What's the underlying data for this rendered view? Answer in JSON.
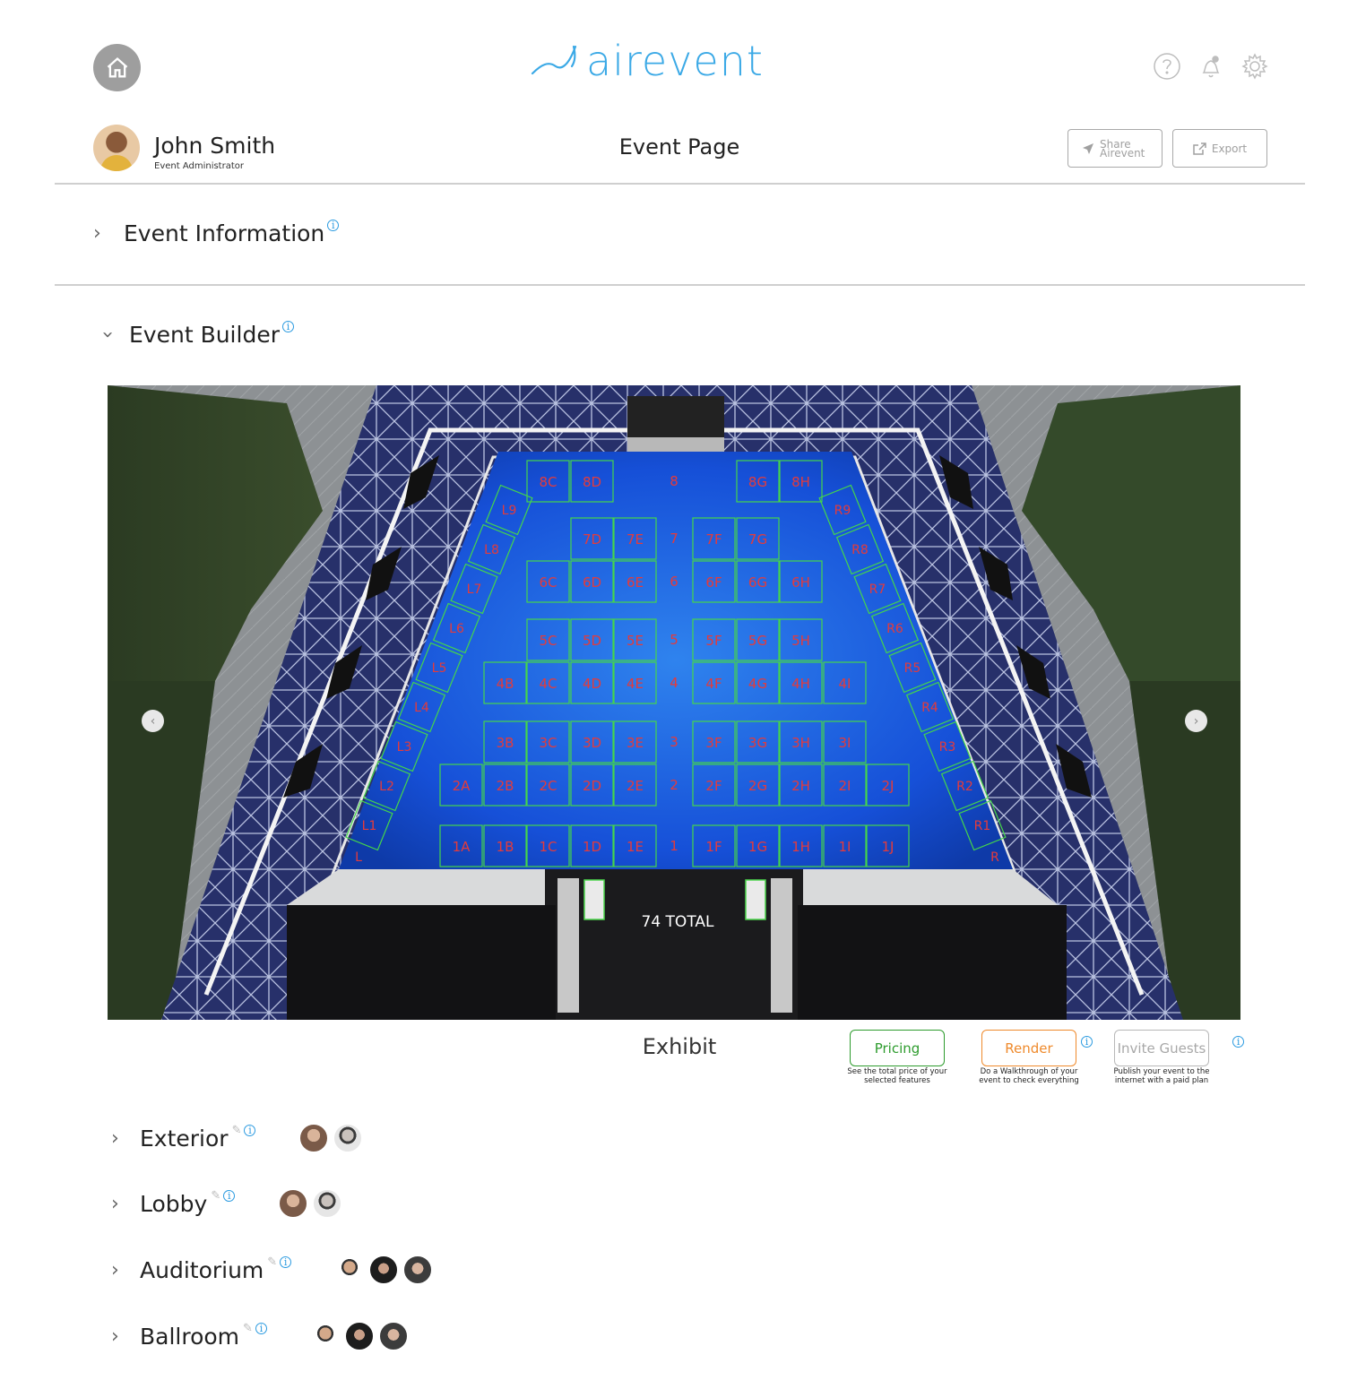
{
  "header": {
    "logo_text": "airevent",
    "home_icon": "home-icon",
    "help_icon": "help-icon",
    "bell_icon": "bell-icon",
    "gear_icon": "gear-icon",
    "brand_color": "#3ba9e6"
  },
  "user": {
    "name": "John Smith",
    "role": "Event Administrator"
  },
  "page": {
    "title": "Event Page",
    "share_label": "Share Airevent",
    "export_label": "Export"
  },
  "sections": {
    "event_information": "Event Information",
    "event_builder": "Event Builder"
  },
  "floorplan": {
    "total_label": "74 TOTAL",
    "row_numbers": [
      "8",
      "7",
      "6",
      "5",
      "4",
      "3",
      "2",
      "1"
    ],
    "booths": [
      "8C",
      "8D",
      "8G",
      "8H",
      "7D",
      "7E",
      "7F",
      "7G",
      "6C",
      "6D",
      "6E",
      "6F",
      "6G",
      "6H",
      "5C",
      "5D",
      "5E",
      "5F",
      "5G",
      "5H",
      "4B",
      "4C",
      "4D",
      "4E",
      "4F",
      "4G",
      "4H",
      "4I",
      "3B",
      "3C",
      "3D",
      "3E",
      "3F",
      "3G",
      "3H",
      "3I",
      "2A",
      "2B",
      "2C",
      "2D",
      "2E",
      "2F",
      "2G",
      "2H",
      "2I",
      "2J",
      "1A",
      "1B",
      "1C",
      "1D",
      "1E",
      "1F",
      "1G",
      "1H",
      "1I",
      "1J"
    ],
    "left_booths": [
      "L9",
      "L8",
      "L7",
      "L6",
      "L5",
      "L4",
      "L3",
      "L2",
      "L1"
    ],
    "left_end": "L",
    "right_booths": [
      "R9",
      "R8",
      "R7",
      "R6",
      "R5",
      "R4",
      "R3",
      "R2",
      "R1"
    ],
    "right_end": "R"
  },
  "builder": {
    "exhibit_label": "Exhibit",
    "pricing_label": "Pricing",
    "pricing_note": "See the total price of your selected features",
    "render_label": "Render",
    "render_note": "Do a Walkthrough of your event to check everything",
    "invite_label": "Invite Guests",
    "invite_note": "Publish your event to the internet with a paid plan",
    "pricing_color": "#2e9c2e",
    "render_color": "#ef8a2c"
  },
  "spaces": [
    {
      "name": "Exterior"
    },
    {
      "name": "Lobby"
    },
    {
      "name": "Auditorium"
    },
    {
      "name": "Ballroom"
    }
  ]
}
